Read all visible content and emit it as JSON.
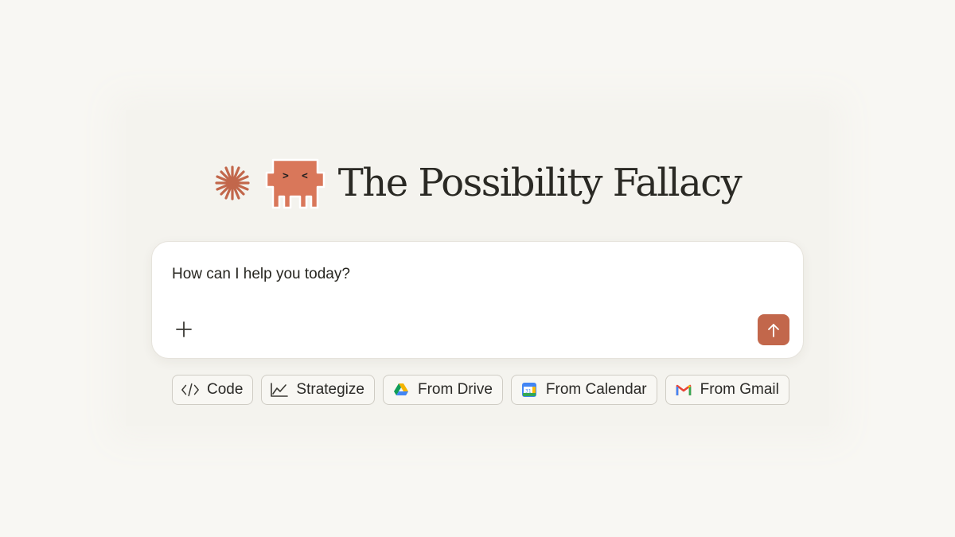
{
  "header": {
    "title": "The Possibility Fallacy",
    "mascot_eyes": {
      "left": ">",
      "right": "<"
    }
  },
  "composer": {
    "prompt": "How can I help you today?",
    "add_icon": "plus-icon",
    "send_icon": "arrow-up-icon"
  },
  "chips": [
    {
      "label": "Code",
      "icon": "code-icon"
    },
    {
      "label": "Strategize",
      "icon": "line-chart-icon"
    },
    {
      "label": "From Drive",
      "icon": "google-drive-icon"
    },
    {
      "label": "From Calendar",
      "icon": "google-calendar-icon"
    },
    {
      "label": "From Gmail",
      "icon": "gmail-icon"
    }
  ],
  "colors": {
    "accent": "#c2674b",
    "background": "#f8f7f3",
    "text": "#2b2a27"
  }
}
